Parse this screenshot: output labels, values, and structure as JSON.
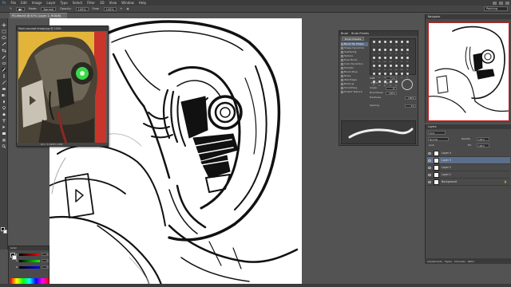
{
  "menu": [
    "Ps",
    "File",
    "Edit",
    "Image",
    "Layer",
    "Type",
    "Select",
    "Filter",
    "3D",
    "View",
    "Window",
    "Help"
  ],
  "options": {
    "mode_label": "Mode:",
    "mode_value": "Normal",
    "opacity_label": "Opacity:",
    "opacity_value": "100%",
    "flow_label": "Flow:",
    "flow_value": "100%",
    "workspace": "Painting"
  },
  "document_tab": "PG-Mech8 @ 67% (Layer 2, RGB/8)",
  "reference_window": {
    "title": "Mech-concept-image.jpg @ 100%",
    "status": "Doc: 1.09M/1.09M"
  },
  "brush_panel": {
    "tabs": [
      "Brush",
      "Brush Presets"
    ],
    "presets_button": "Brush Presets",
    "categories": [
      "Brush Tip Shape",
      "Shape Dynamics",
      "Scattering",
      "Texture",
      "Dual Brush",
      "Color Dynamics",
      "Transfer",
      "Brush Pose",
      "Noise",
      "Wet Edges",
      "Build-up",
      "Smoothing",
      "Protect Texture"
    ],
    "selected_category": "Brush Tip Shape",
    "tip_sizes": [
      "1",
      "3",
      "5",
      "9",
      "13",
      "19",
      "5",
      "9",
      "13",
      "17",
      "21",
      "27",
      "35",
      "45",
      "65",
      "100",
      "200",
      "300",
      "9",
      "13",
      "19",
      "17",
      "45",
      "65",
      "100",
      "200",
      "300",
      "14",
      "24",
      "27",
      "39",
      "46",
      "59",
      "11",
      "17",
      "23",
      "36",
      "44",
      "60",
      "14"
    ],
    "size_label": "Size",
    "size_value": "7 px",
    "flip_x": "Flip X",
    "flip_y": "Flip Y",
    "angle_label": "Angle:",
    "angle_value": "0°",
    "roundness_label": "Roundness:",
    "roundness_value": "100%",
    "hardness_label": "Hardness",
    "hardness_value": "100%",
    "spacing_label": "Spacing",
    "spacing_value": "1%"
  },
  "navigator": {
    "tabs": "Navigator"
  },
  "layers": {
    "tabs": "Layers",
    "kind_label": "Kind",
    "blend": "Normal",
    "opacity_label": "Opacity:",
    "opacity_value": "100%",
    "lock_label": "Lock:",
    "fill_label": "Fill:",
    "fill_value": "100%",
    "items": [
      {
        "name": "Layer 4"
      },
      {
        "name": "Layer 3"
      },
      {
        "name": "Layer 2"
      },
      {
        "name": "Layer 1"
      },
      {
        "name": "Background"
      }
    ],
    "selected": "Layer 3"
  },
  "bottom_tabs": [
    "Adjustments",
    "Styles",
    "Channels",
    "Paths"
  ],
  "color_panel": {
    "tabs": "Color",
    "r_label": "R",
    "r_value": "0",
    "g_label": "G",
    "g_value": "0",
    "b_label": "B",
    "b_value": "0"
  },
  "colors": {
    "chrome": "#535353",
    "panel": "#4a4a4a",
    "selection": "#5b6f8c",
    "reference_bg": "#e2b53a",
    "eye_glow": "#3bd64a"
  }
}
